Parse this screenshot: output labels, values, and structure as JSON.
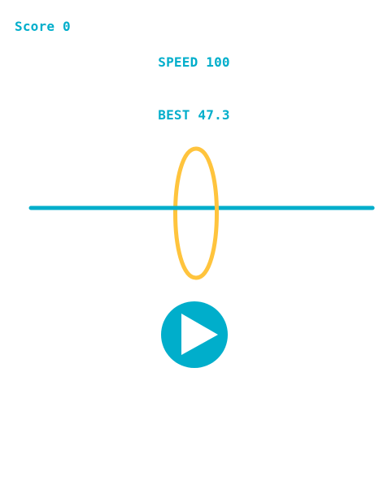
{
  "hud": {
    "score_text": "Score 0",
    "speed_text": "SPEED 100",
    "best_text": "BEST 47.3"
  },
  "colors": {
    "accent": "#00AECB",
    "ring": "#FFC43D",
    "background": "#FFFFFF",
    "play_icon": "#FFFFFF"
  },
  "icons": {
    "play": "play-icon"
  }
}
